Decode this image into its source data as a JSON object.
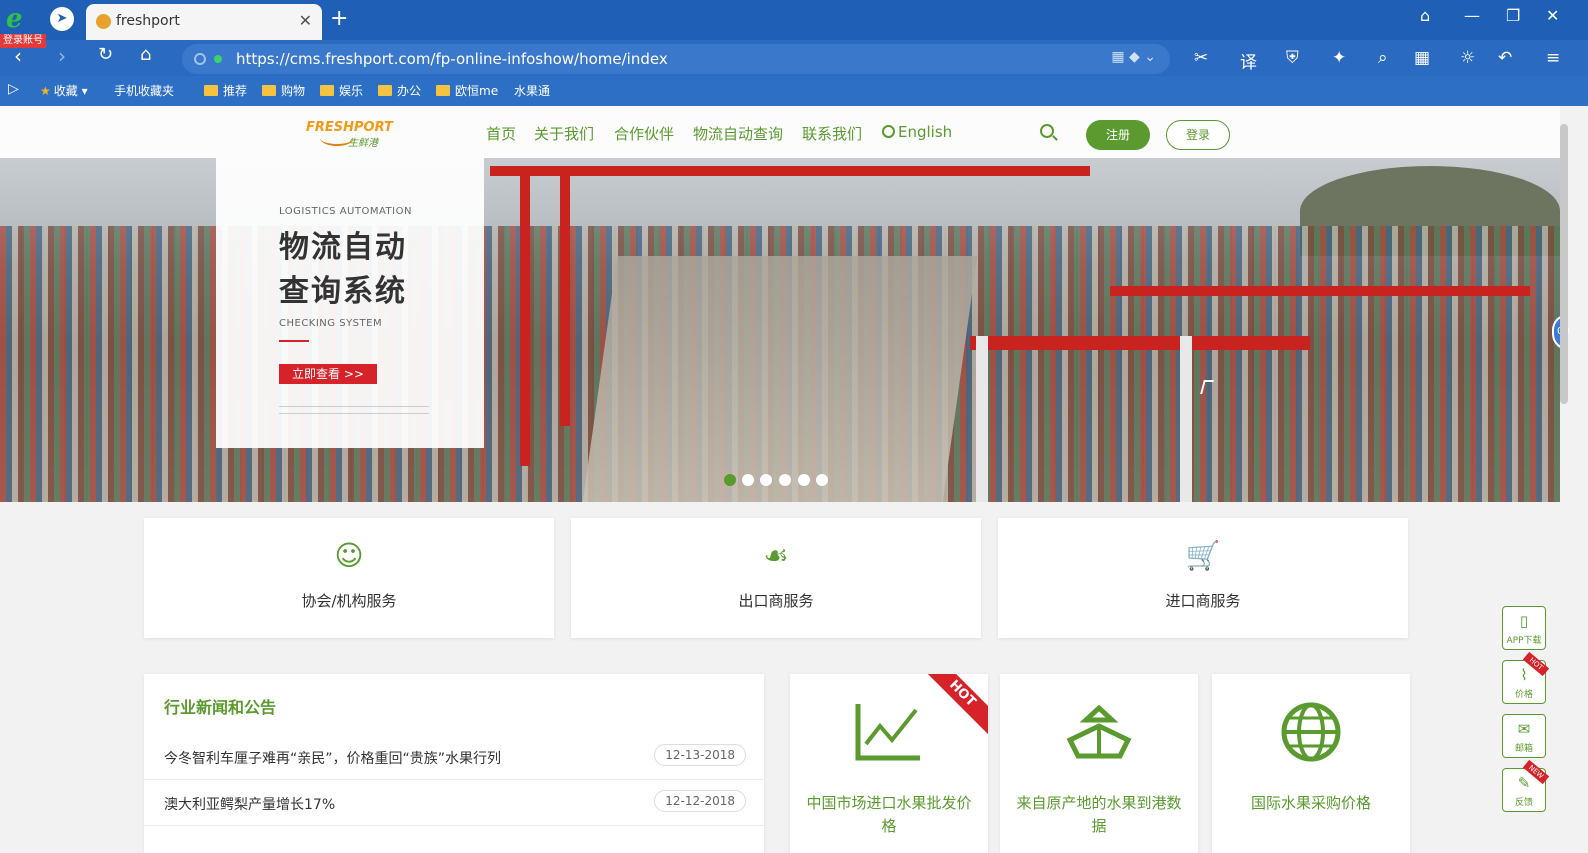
{
  "browser": {
    "account_badge": "登录账号",
    "tab_title": "freshport",
    "url": "https://cms.freshport.com/fp-online-infoshow/home/index",
    "bookmarks": [
      {
        "label": "收藏",
        "type": "star"
      },
      {
        "label": "手机收藏夹",
        "type": "page"
      },
      {
        "label": "推荐",
        "type": "folder"
      },
      {
        "label": "购物",
        "type": "folder"
      },
      {
        "label": "娱乐",
        "type": "folder"
      },
      {
        "label": "办公",
        "type": "folder"
      },
      {
        "label": "欧恒me",
        "type": "folder"
      },
      {
        "label": "水果通",
        "type": "page"
      }
    ]
  },
  "site": {
    "logo_text": "FRESHPORT",
    "logo_sub": "生鲜港",
    "menu": [
      "首页",
      "关于我们",
      "合作伙伴",
      "物流自动查询",
      "联系我们"
    ],
    "language": "English",
    "register": "注册",
    "login": "登录"
  },
  "banner": {
    "kicker": "LOGISTICS AUTOMATION",
    "headline_1": "物流自动",
    "headline_2": "查询系统",
    "sub": "CHECKING SYSTEM",
    "cta": "立即查看 >>",
    "slides": 6,
    "active_slide": 1
  },
  "services": [
    {
      "label": "协会/机构服务",
      "icon": "people-icon"
    },
    {
      "label": "出口商服务",
      "icon": "hand-fruit-icon"
    },
    {
      "label": "进口商服务",
      "icon": "cart-icon"
    }
  ],
  "news": {
    "title": "行业新闻和公告",
    "items": [
      {
        "text": "今冬智利车厘子难再“亲民”，价格重回“贵族”水果行列",
        "date": "12-13-2018"
      },
      {
        "text": "澳大利亚鳄梨产量增长17%",
        "date": "12-12-2018"
      },
      {
        "text": "",
        "date": ""
      }
    ]
  },
  "features": [
    {
      "label": "中国市场进口水果批发价格",
      "icon": "line-chart-icon",
      "ribbon": "HOT"
    },
    {
      "label": "来自原产地的水果到港数据",
      "icon": "ship-icon",
      "ribbon": ""
    },
    {
      "label": "国际水果采购价格",
      "icon": "globe-icon",
      "ribbon": ""
    }
  ],
  "floating": [
    {
      "label": "APP下载",
      "icon": "app-icon",
      "tag": ""
    },
    {
      "label": "价格",
      "icon": "chart-icon",
      "tag": "HOT"
    },
    {
      "label": "邮箱",
      "icon": "mail-icon",
      "tag": ""
    },
    {
      "label": "反馈",
      "icon": "feedback-icon",
      "tag": "NEW"
    }
  ],
  "colors": {
    "brand_green": "#5a9a2e",
    "accent_red": "#d6232a",
    "logo_orange": "#f29a16",
    "browser_blue": "#1f5fb5"
  }
}
